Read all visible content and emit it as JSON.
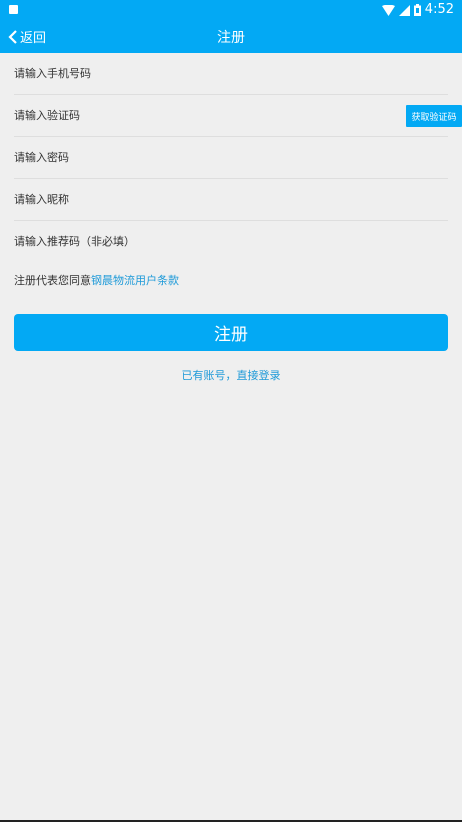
{
  "status_bar": {
    "time": "4:52",
    "icons": [
      "notification-icon",
      "wifi-icon",
      "signal-icon",
      "battery-icon"
    ]
  },
  "app_bar": {
    "back_label": "返回",
    "title": "注册"
  },
  "form": {
    "phone": {
      "value": "",
      "placeholder": "请输入手机号码"
    },
    "code": {
      "value": "",
      "placeholder": "请输入验证码"
    },
    "get_code_label": "获取验证码",
    "password": {
      "value": "",
      "placeholder": "请输入密码"
    },
    "nickname": {
      "value": "",
      "placeholder": "请输入昵称"
    },
    "referral": {
      "value": "",
      "placeholder": "请输入推荐码（非必填）"
    }
  },
  "agreement": {
    "prefix": "注册代表您同意",
    "link": "钢晨物流用户条款"
  },
  "register_label": "注册",
  "login_link": "已有账号，直接登录",
  "colors": {
    "primary": "#03a9f4",
    "link": "#1e9ad8",
    "background": "#efefef"
  }
}
